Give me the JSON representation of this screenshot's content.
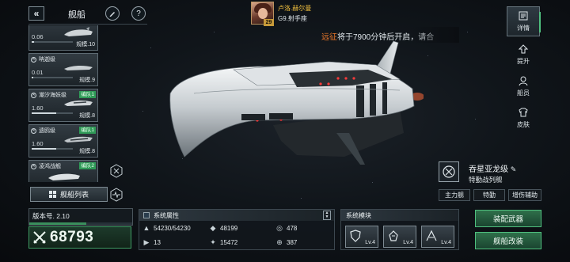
{
  "header": {
    "back_icon": "chevron-left-icon",
    "title": "舰船",
    "edit_icon": "pen-icon",
    "help_icon": "question-icon"
  },
  "commander": {
    "name": "卢洛.赫尔曼",
    "rank": "G9.射手座",
    "level": "29"
  },
  "notice": {
    "highlight": "远征",
    "text": "将于7900分钟后开启，请合"
  },
  "ship_list": [
    {
      "value": "0.06",
      "scale": "规模.10",
      "progress": 0.05
    },
    {
      "name": "呐迦级",
      "value": "0.01",
      "scale": "规模.9",
      "progress": 0.01
    },
    {
      "name": "潮汐海妖级",
      "tag": "编队1",
      "value": "1.60",
      "scale": "规模.8",
      "progress": 0.6
    },
    {
      "name": "遗鸥级",
      "tag": "编队1",
      "value": "1.60",
      "scale": "规模.8",
      "progress": 0.6
    },
    {
      "name": "凌鸿战舰",
      "tag": "编队2"
    }
  ],
  "fleet_list_button": "舰船列表",
  "version": {
    "label": "版本号. 2.10",
    "progress": 0.55
  },
  "power": "68793",
  "system_attributes": {
    "title": "系统属性",
    "items": [
      {
        "icon": "durability-icon",
        "value": "54230/54230"
      },
      {
        "icon": "armor-icon",
        "value": "48199"
      },
      {
        "icon": "shield-icon",
        "value": "478"
      },
      {
        "icon": "speed-icon",
        "value": "13"
      },
      {
        "icon": "firepower-icon",
        "value": "15472"
      },
      {
        "icon": "target-icon",
        "value": "387"
      }
    ]
  },
  "system_modules": {
    "title": "系统模块",
    "modules": [
      {
        "icon": "shield-module-icon",
        "level": "Lv.4"
      },
      {
        "icon": "fist-module-icon",
        "level": "Lv.4"
      },
      {
        "icon": "boost-module-icon",
        "level": "Lv.4"
      }
    ]
  },
  "buttons": {
    "equip_weapons": "装配武器",
    "refit": "舰船改装"
  },
  "right_nav": [
    {
      "label": "详情",
      "icon": "info-icon",
      "active": true
    },
    {
      "label": "提升",
      "icon": "upgrade-icon",
      "active": false
    },
    {
      "label": "船员",
      "icon": "crew-icon",
      "active": false
    },
    {
      "label": "皮肤",
      "icon": "skin-icon",
      "active": false
    }
  ],
  "ship": {
    "class_name": "吞星亚龙级",
    "type": "特勤战列舰",
    "roles": [
      "主力舰",
      "特勤",
      "增伤辅助"
    ]
  },
  "colors": {
    "accent_green": "#3e9a63",
    "notice_orange": "#f07a2a",
    "commander_gold": "#f2c13e"
  }
}
